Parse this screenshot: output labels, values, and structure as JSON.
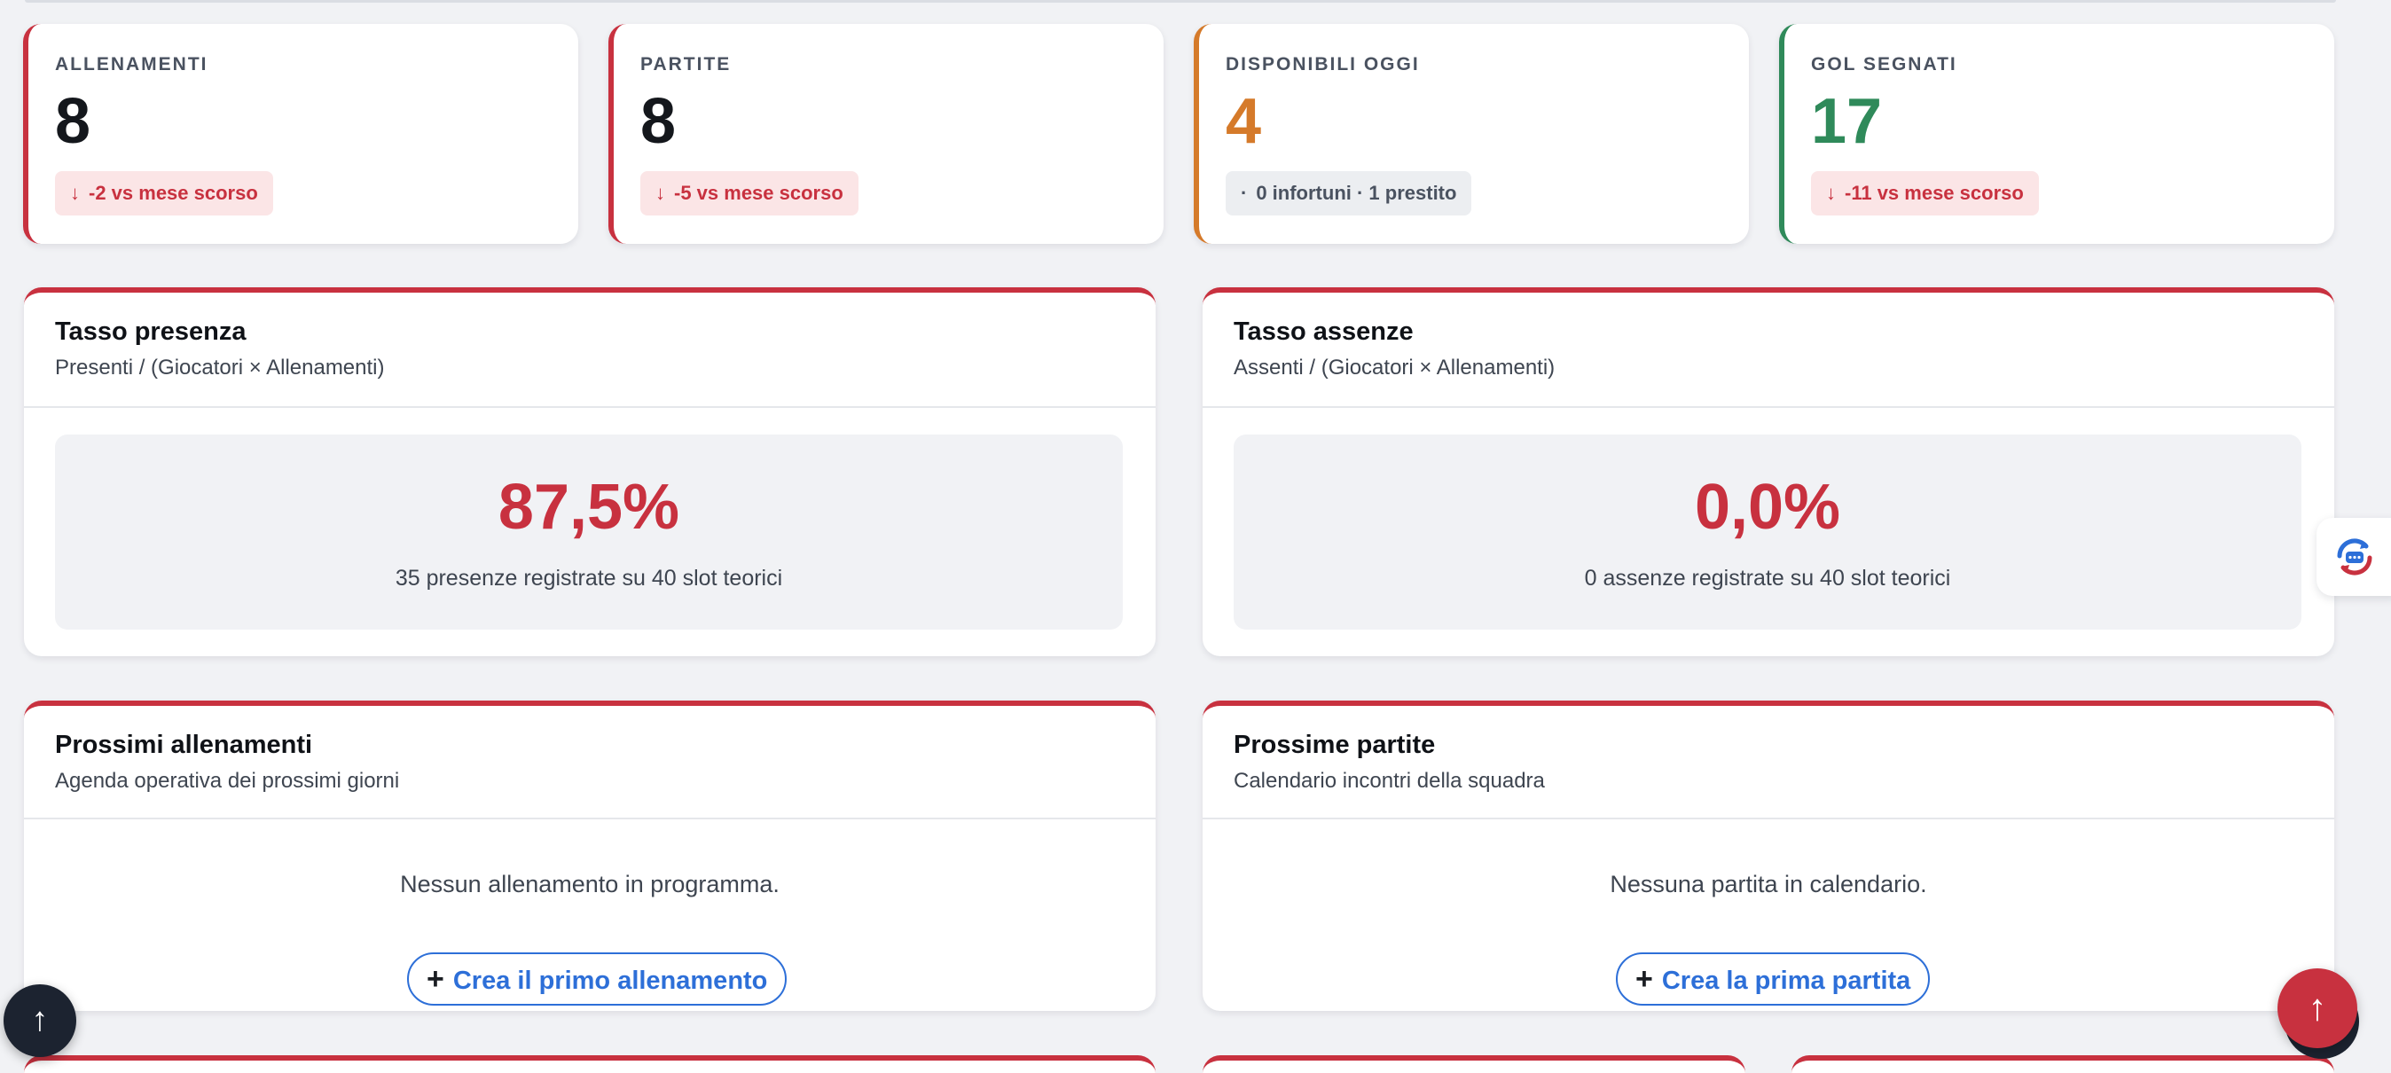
{
  "kpis": [
    {
      "label": "ALLENAMENTI",
      "value": "8",
      "arrow": "↓",
      "badge": "-2 vs mese scorso",
      "accent": "#c8313f",
      "value_color": "#14171c"
    },
    {
      "label": "PARTITE",
      "value": "8",
      "arrow": "↓",
      "badge": "-5 vs mese scorso",
      "accent": "#c8313f",
      "value_color": "#14171c"
    },
    {
      "label": "DISPONIBILI OGGI",
      "value": "4",
      "arrow": "·",
      "badge": "0 infortuni · 1 prestito",
      "accent": "#d57a2a",
      "value_color": "#d57a2a"
    },
    {
      "label": "GOL SEGNATI",
      "value": "17",
      "arrow": "↓",
      "badge": "-11 vs mese scorso",
      "accent": "#2f8a5a",
      "value_color": "#2f8a5a"
    }
  ],
  "presence": {
    "title": "Tasso presenza",
    "subtitle": "Presenti / (Giocatori × Allenamenti)",
    "value": "87,5%",
    "caption": "35 presenze registrate su 40 slot teorici"
  },
  "absence": {
    "title": "Tasso assenze",
    "subtitle": "Assenti / (Giocatori × Allenamenti)",
    "value": "0,0%",
    "caption": "0 assenze registrate su 40 slot teorici"
  },
  "trainings": {
    "title": "Prossimi allenamenti",
    "subtitle": "Agenda operativa dei prossimi giorni",
    "empty": "Nessun allenamento in programma.",
    "button_icon": "+",
    "button": "Crea il primo allenamento"
  },
  "matches": {
    "title": "Prossime partite",
    "subtitle": "Calendario incontri della squadra",
    "empty": "Nessuna partita in calendario.",
    "button_icon": "+",
    "button": "Crea la prima partita"
  },
  "floating": {
    "scroll_top_left": "↑",
    "scroll_top_right": "↑",
    "side_widget_icon": "chat-sync-icon"
  },
  "colors": {
    "primary_red": "#c8313f",
    "orange": "#d57a2a",
    "green": "#2f8a5a",
    "link_blue": "#2d6fd8"
  }
}
